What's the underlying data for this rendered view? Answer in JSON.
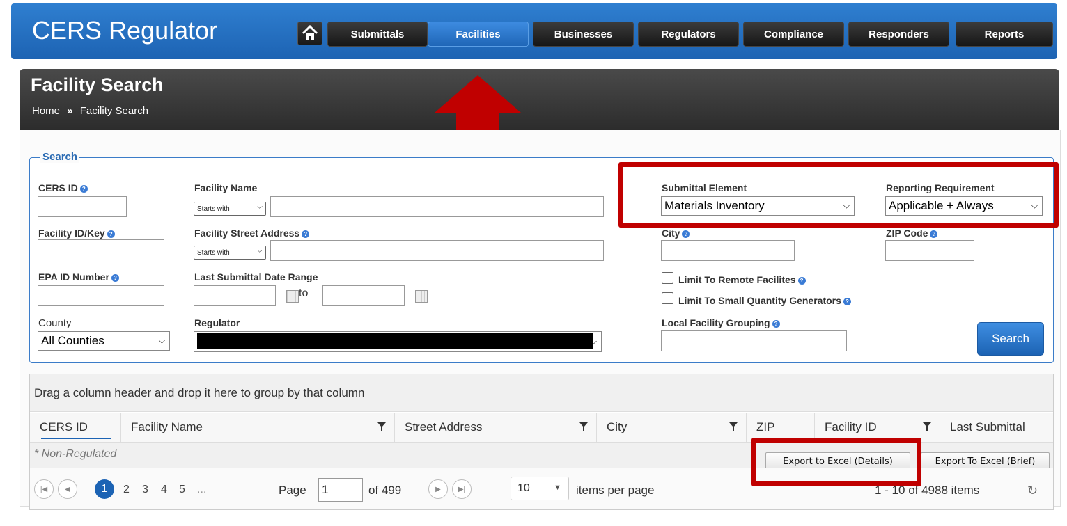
{
  "app": {
    "title": "CERS Regulator"
  },
  "nav": {
    "home_icon": "home-icon",
    "items": [
      "Submittals",
      "Facilities",
      "Businesses",
      "Regulators",
      "Compliance",
      "Responders",
      "Reports"
    ],
    "active": "Facilities"
  },
  "page": {
    "title": "Facility Search",
    "breadcrumb_home": "Home",
    "breadcrumb_sep": "»",
    "breadcrumb_current": "Facility Search"
  },
  "search": {
    "legend": "Search",
    "cers_id_label": "CERS ID",
    "facility_name_label": "Facility Name",
    "name_match": "Starts with",
    "facility_key_label": "Facility ID/Key",
    "street_label": "Facility Street Address",
    "street_match": "Starts with",
    "epa_label": "EPA ID Number",
    "date_label": "Last Submittal Date Range",
    "to_label": "to",
    "county_label": "County",
    "county_value": "All Counties",
    "regulator_label": "Regulator",
    "submittal_label": "Submittal Element",
    "submittal_value": "Materials Inventory",
    "reporting_label": "Reporting Requirement",
    "reporting_value": "Applicable + Always",
    "city_label": "City",
    "zip_label": "ZIP Code",
    "remote_label": "Limit To Remote Facilites",
    "sqg_label": "Limit To Small Quantity Generators",
    "grouping_label": "Local Facility Grouping",
    "search_button": "Search"
  },
  "grid": {
    "group_hint": "Drag a column header and drop it here to group by that column",
    "columns": [
      "CERS ID",
      "Facility Name",
      "Street Address",
      "City",
      "ZIP",
      "Facility ID",
      "Last Submittal"
    ],
    "non_regulated": "* Non-Regulated",
    "export_details": "Export to Excel (Details)",
    "export_brief": "Export To Excel (Brief)"
  },
  "pager": {
    "pages": [
      "1",
      "2",
      "3",
      "4",
      "5",
      "..."
    ],
    "page_label": "Page",
    "page_value": "1",
    "of_label": "of 499",
    "per_page_value": "10",
    "per_page_label": "items per page",
    "summary": "1 - 10 of 4988 items"
  },
  "colors": {
    "nav_blue": "#1d63b3",
    "highlight_red": "#c00000",
    "header_dark": "#2c2c2c"
  }
}
